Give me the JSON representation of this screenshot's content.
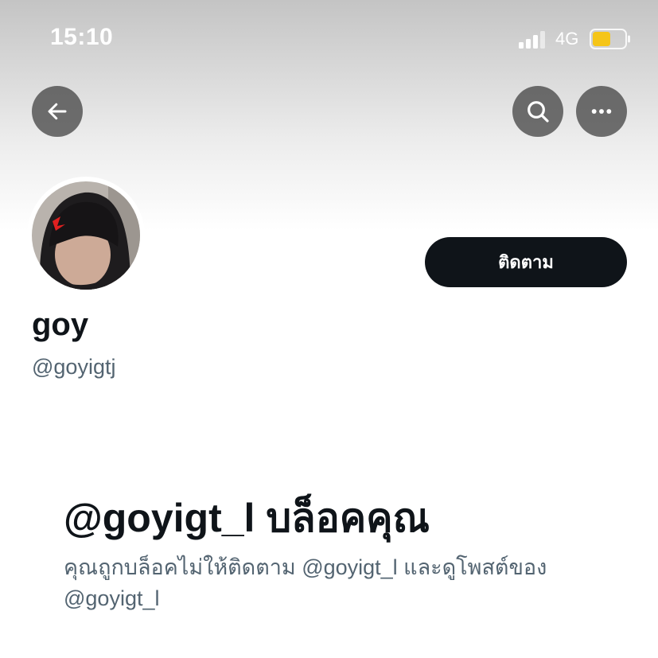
{
  "status_bar": {
    "time": "15:10",
    "network": "4G",
    "battery_color": "#f5c518"
  },
  "header": {
    "back_icon": "arrow-left-icon",
    "search_icon": "search-icon",
    "more_icon": "more-horizontal-icon"
  },
  "profile": {
    "display_name": "goy",
    "handle": "@goyigtj",
    "follow_label": "ติดตาม"
  },
  "blocked": {
    "title": "@goyigt_l บล็อคคุณ",
    "description": "คุณถูกบล็อคไม่ให้ติดตาม @goyigt_l และดูโพสต์ของ @goyigt_l"
  },
  "colors": {
    "primary_text": "#0f1419",
    "secondary_text": "#536471",
    "button_bg": "#0f1419"
  }
}
